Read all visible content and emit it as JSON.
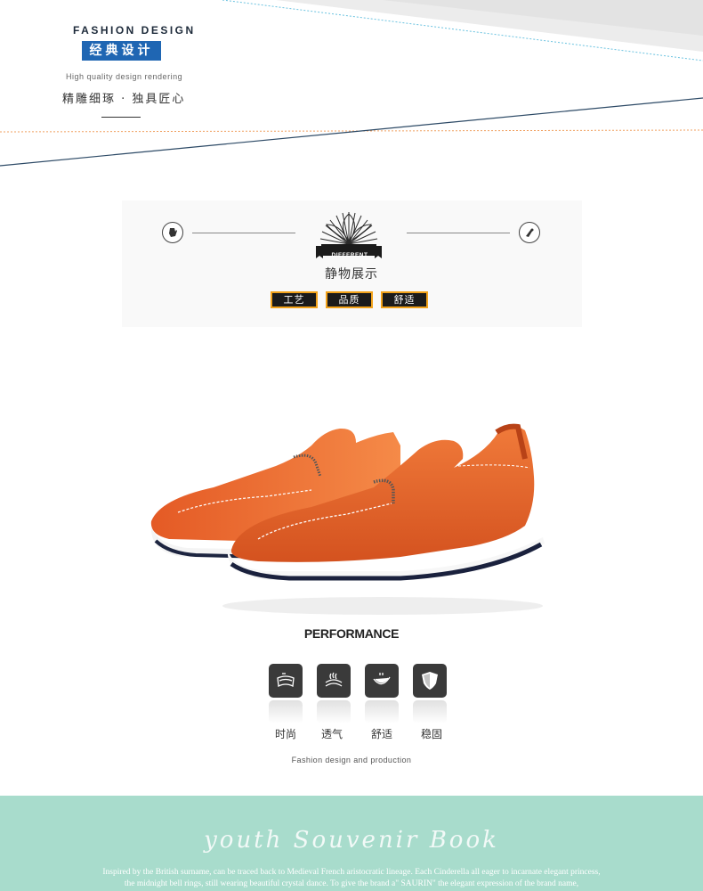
{
  "header": {
    "title_en": "FASHION DESIGN",
    "title_cn": "经典设计",
    "subtitle_en": "High quality design rendering",
    "slogan_cn": "精雕细琢 · 独具匠心"
  },
  "still_life": {
    "badge_label": "DIFFERENT",
    "title": "静物展示",
    "tags": [
      "工艺",
      "品质",
      "舒适"
    ]
  },
  "performance": {
    "title": "PERFORMANCE",
    "features": [
      {
        "label": "时尚",
        "icon": "layers-icon"
      },
      {
        "label": "透气",
        "icon": "breathable-icon"
      },
      {
        "label": "舒适",
        "icon": "flexible-sole-icon"
      },
      {
        "label": "稳固",
        "icon": "shield-icon"
      }
    ],
    "subtitle": "Fashion design and production"
  },
  "footer": {
    "script_title": "youth Souvenir Book",
    "text_line1": "Inspired by the British surname, can be traced back to Medieval French aristocratic lineage. Each Cinderella all eager to incarnate elegant princess,",
    "text_line2": "the midnight bell rings, still wearing beautiful crystal dance. To give the brand a\" SAURIN\" the elegant expression of the brand name,"
  },
  "colors": {
    "badge_blue": "#1f66b3",
    "tag_border": "#f2a21a",
    "footer_bg": "#a8dccc",
    "shoe_orange": "#e5632a"
  }
}
